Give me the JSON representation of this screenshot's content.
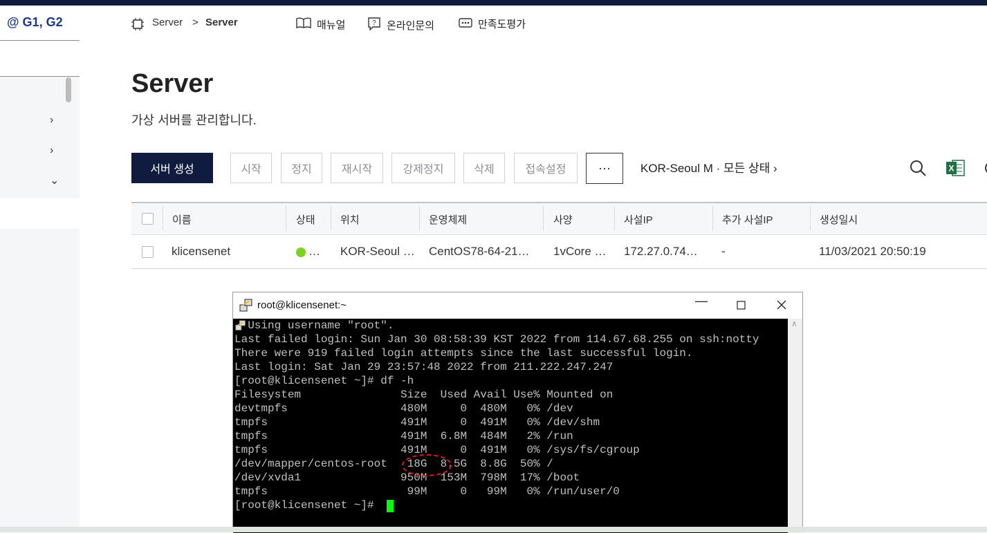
{
  "sidebar": {
    "brand": "@ G1, G2"
  },
  "breadcrumb": {
    "parent": "Server",
    "separator": ">",
    "current": "Server"
  },
  "nav": {
    "manual": "매뉴얼",
    "inquiry": "온라인문의",
    "survey": "만족도평가"
  },
  "page": {
    "title": "Server",
    "description": "가상 서버를 관리합니다."
  },
  "toolbar": {
    "create": "서버 생성",
    "start": "시작",
    "stop": "정지",
    "restart": "재시작",
    "force_stop": "강제정지",
    "delete": "삭제",
    "access": "접속설정",
    "more": "···",
    "filter": "KOR-Seoul M · 모든 상태 ›"
  },
  "table": {
    "headers": [
      "이름",
      "상태",
      "위치",
      "운영체제",
      "사양",
      "사설IP",
      "추가 사설IP",
      "생성일시"
    ],
    "rows": [
      {
        "name": "klicensenet",
        "status": "…",
        "location": "KOR-Seoul …",
        "os": "CentOS78-64-21…",
        "spec": "1vCore …",
        "private_ip": "172.27.0.74…",
        "extra_ip": "-",
        "created": "11/03/2021 20:50:19"
      }
    ]
  },
  "terminal": {
    "title": "root@klicensenet:~",
    "lines": [
      "  Using username \"root\".",
      "Last failed login: Sun Jan 30 08:58:39 KST 2022 from 114.67.68.255 on ssh:notty",
      "There were 919 failed login attempts since the last successful login.",
      "Last login: Sat Jan 29 23:57:48 2022 from 211.222.247.247",
      "[root@klicensenet ~]# df -h",
      "Filesystem               Size  Used Avail Use% Mounted on",
      "devtmpfs                 480M     0  480M   0% /dev",
      "tmpfs                    491M     0  491M   0% /dev/shm",
      "tmpfs                    491M  6.8M  484M   2% /run",
      "tmpfs                    491M     0  491M   0% /sys/fs/cgroup",
      "/dev/mapper/centos-root   18G  8.5G  8.8G  50% /",
      "/dev/xvda1               950M  153M  798M  17% /boot",
      "tmpfs                     99M     0   99M   0% /run/user/0",
      "[root@klicensenet ~]# "
    ]
  }
}
